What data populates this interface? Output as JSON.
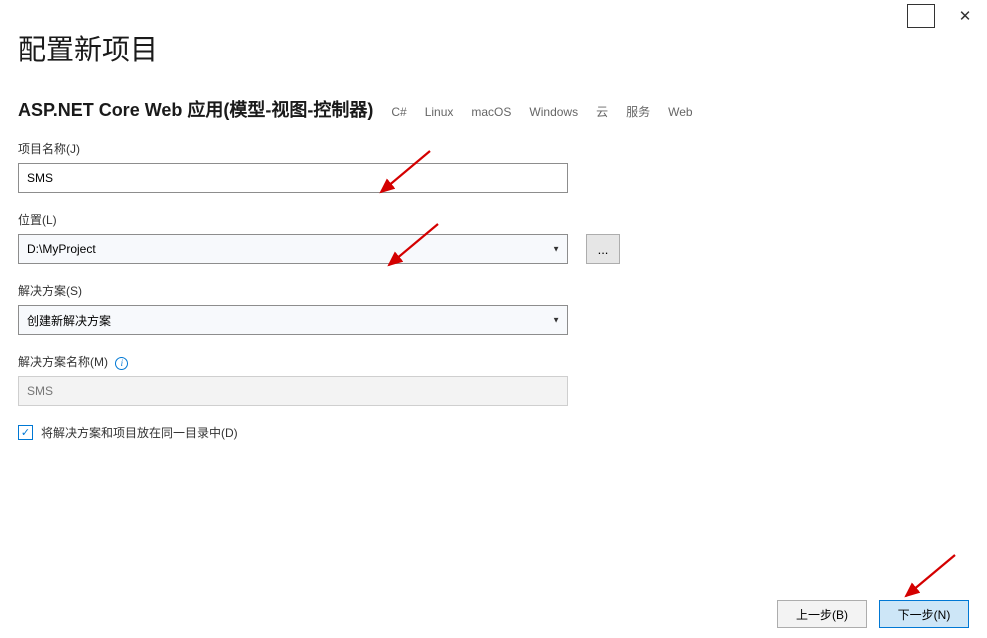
{
  "window": {
    "title": "配置新项目"
  },
  "project": {
    "type_title": "ASP.NET Core Web 应用(模型-视图-控制器)",
    "tags": [
      "C#",
      "Linux",
      "macOS",
      "Windows",
      "云",
      "服务",
      "Web"
    ]
  },
  "form": {
    "project_name": {
      "label": "项目名称(J)",
      "value": "SMS"
    },
    "location": {
      "label": "位置(L)",
      "value": "D:\\MyProject",
      "browse_label": "..."
    },
    "solution": {
      "label": "解决方案(S)",
      "value": "创建新解决方案"
    },
    "solution_name": {
      "label": "解决方案名称(M)",
      "placeholder": "SMS"
    },
    "same_dir_checkbox": {
      "label": "将解决方案和项目放在同一目录中(D)",
      "checked": true
    }
  },
  "footer": {
    "back_label": "上一步(B)",
    "next_label": "下一步(N)"
  }
}
